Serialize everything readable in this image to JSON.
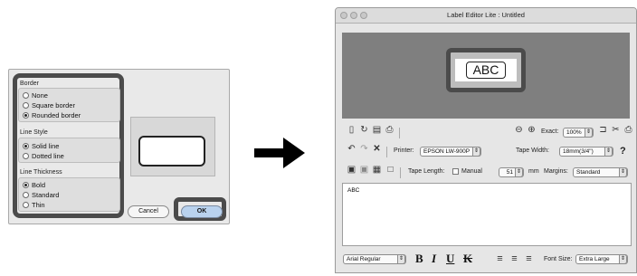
{
  "dialog": {
    "border_group": {
      "label": "Border",
      "options": [
        {
          "label": "None",
          "selected": false
        },
        {
          "label": "Square border",
          "selected": false
        },
        {
          "label": "Rounded border",
          "selected": true
        }
      ]
    },
    "line_style_group": {
      "label": "Line Style",
      "options": [
        {
          "label": "Solid line",
          "selected": true
        },
        {
          "label": "Dotted line",
          "selected": false
        }
      ]
    },
    "line_thickness_group": {
      "label": "Line Thickness",
      "options": [
        {
          "label": "Bold",
          "selected": true
        },
        {
          "label": "Standard",
          "selected": false
        },
        {
          "label": "Thin",
          "selected": false
        }
      ]
    },
    "cancel_label": "Cancel",
    "ok_label": "OK"
  },
  "window": {
    "title": "Label Editor Lite : Untitled",
    "label_preview_text": "ABC",
    "toolbar1": {
      "exact_label": "Exact:",
      "zoom_value": "100%"
    },
    "toolbar2": {
      "printer_label": "Printer:",
      "printer_value": "EPSON LW-900P",
      "tape_width_label": "Tape Width:",
      "tape_width_value": "18mm(3/4\")",
      "help_glyph": "?"
    },
    "toolbar3": {
      "tape_length_label": "Tape Length:",
      "manual_label": "Manual",
      "length_value": "51",
      "length_unit": "mm",
      "margins_label": "Margins:",
      "margins_value": "Standard"
    },
    "editor_text": "ABC",
    "fontbar": {
      "font_value": "Arial Regular",
      "bold": "B",
      "italic": "I",
      "underline": "U",
      "strike": "K",
      "font_size_label": "Font Size:",
      "font_size_value": "Extra Large"
    }
  },
  "colors": {
    "highlight_border": "#4b4b4b",
    "preview_background": "#7f7f7f",
    "ok_button": "#b9d2ee"
  }
}
